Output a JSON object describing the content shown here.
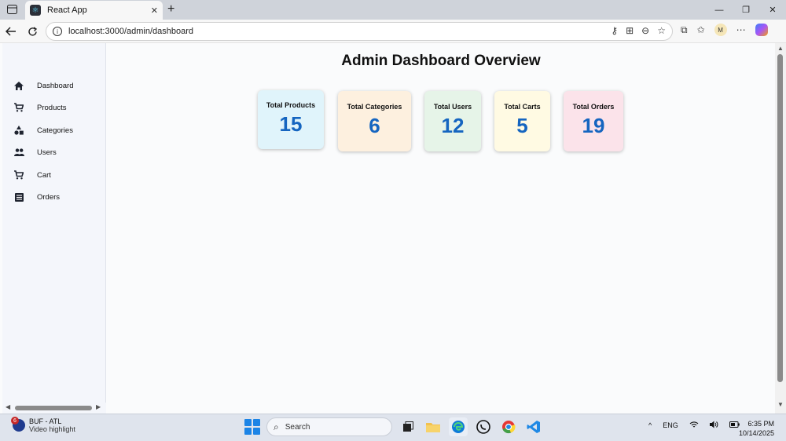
{
  "browser": {
    "tab_title": "React App",
    "tab_close": "✕",
    "new_tab": "+",
    "url": "localhost:3000/admin/dashboard",
    "profile_initial": "M",
    "window_controls": [
      "—",
      "❐",
      "✕"
    ]
  },
  "sidebar": {
    "items": [
      {
        "label": "Dashboard",
        "icon": "home-icon"
      },
      {
        "label": "Products",
        "icon": "cart-icon"
      },
      {
        "label": "Categories",
        "icon": "shapes-icon"
      },
      {
        "label": "Users",
        "icon": "people-icon"
      },
      {
        "label": "Cart",
        "icon": "cart-icon"
      },
      {
        "label": "Orders",
        "icon": "list-icon"
      }
    ]
  },
  "main": {
    "title": "Admin Dashboard Overview",
    "value_color": "#1565c0",
    "cards": [
      {
        "label": "Total Products",
        "value": "15",
        "bg": "#e0f4fb"
      },
      {
        "label": "Total Categories",
        "value": "6",
        "bg": "#fdf0df"
      },
      {
        "label": "Total Users",
        "value": "12",
        "bg": "#e6f4e8"
      },
      {
        "label": "Total Carts",
        "value": "5",
        "bg": "#fffae3"
      },
      {
        "label": "Total Orders",
        "value": "19",
        "bg": "#fbe3ea"
      }
    ]
  },
  "taskbar": {
    "widget_badge": "6",
    "widget_line1": "BUF - ATL",
    "widget_line2": "Video highlight",
    "search_placeholder": "Search",
    "tray_lang": "ENG",
    "time": "6:35 PM",
    "date": "10/14/2025"
  }
}
